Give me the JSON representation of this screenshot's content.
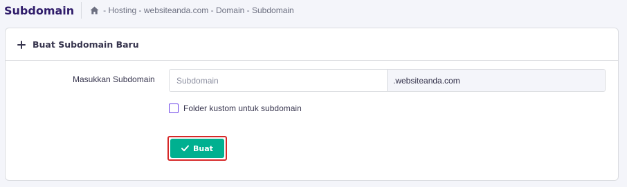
{
  "header": {
    "title": "Subdomain",
    "breadcrumb": [
      "Hosting",
      "websiteanda.com",
      "Domain",
      "Subdomain"
    ],
    "separator": "-"
  },
  "card": {
    "title": "Buat Subdomain Baru",
    "form": {
      "label": "Masukkan Subdomain",
      "subdomain_placeholder": "Subdomain",
      "subdomain_value": "",
      "domain_suffix": ".websiteanda.com",
      "checkbox_label": "Folder kustom untuk subdomain",
      "checkbox_checked": false,
      "submit_label": "Buat"
    }
  },
  "colors": {
    "title": "#2f1c6a",
    "accent": "#673de6",
    "button": "#00b090",
    "highlight": "#d62828",
    "background": "#f4f5fa"
  },
  "icons": {
    "home": "home-icon",
    "plus": "plus-icon",
    "check": "check-icon"
  }
}
